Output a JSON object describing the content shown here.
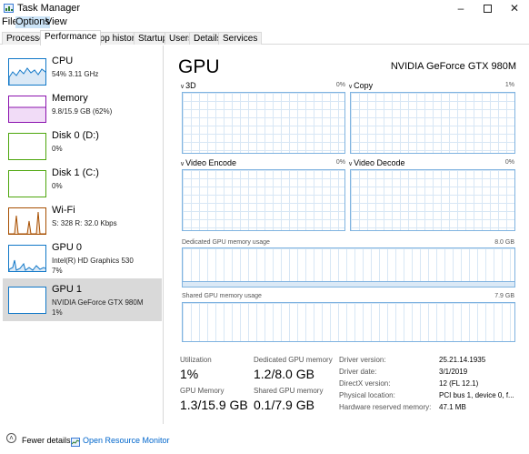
{
  "window": {
    "title": "Task Manager",
    "minimize": "–",
    "close": "✕"
  },
  "menu": [
    "File",
    "Options",
    "View"
  ],
  "tabs": [
    "Processes",
    "Performance",
    "App history",
    "Startup",
    "Users",
    "Details",
    "Services"
  ],
  "active_tab": "Performance",
  "sidebar": [
    {
      "name": "CPU",
      "detail1": "54%  3.11 GHz",
      "detail2": "",
      "color": "#1178c8",
      "icon": "cpu-graph-icon"
    },
    {
      "name": "Memory",
      "detail1": "9.8/15.9 GB (62%)",
      "detail2": "",
      "color": "#8b12ae",
      "icon": "memory-graph-icon"
    },
    {
      "name": "Disk 0 (D:)",
      "detail1": "0%",
      "detail2": "",
      "color": "#4da60c",
      "icon": "disk-graph-icon"
    },
    {
      "name": "Disk 1 (C:)",
      "detail1": "0%",
      "detail2": "",
      "color": "#4da60c",
      "icon": "disk-graph-icon"
    },
    {
      "name": "Wi-Fi",
      "detail1": "S: 328  R: 32.0 Kbps",
      "detail2": "",
      "color": "#a74f01",
      "icon": "network-graph-icon"
    },
    {
      "name": "GPU 0",
      "detail1": "Intel(R) HD Graphics 530",
      "detail2": "7%",
      "color": "#1178c8",
      "icon": "gpu-graph-icon"
    },
    {
      "name": "GPU 1",
      "detail1": "NVIDIA GeForce GTX 980M",
      "detail2": "1%",
      "color": "#1178c8",
      "icon": "gpu-graph-icon"
    }
  ],
  "selected_index": 6,
  "main": {
    "title": "GPU",
    "model": "NVIDIA GeForce GTX 980M",
    "engines": [
      {
        "name": "3D",
        "pct": "0%"
      },
      {
        "name": "Copy",
        "pct": "1%"
      },
      {
        "name": "Video Encode",
        "pct": "0%"
      },
      {
        "name": "Video Decode",
        "pct": "0%"
      }
    ],
    "dedicated_label": "Dedicated GPU memory usage",
    "dedicated_max": "8.0 GB",
    "shared_label": "Shared GPU memory usage",
    "shared_max": "7.9 GB"
  },
  "stats": {
    "utilization_label": "Utilization",
    "utilization": "1%",
    "dedicated_label": "Dedicated GPU memory",
    "dedicated": "1.2/8.0 GB",
    "gpu_memory_label": "GPU Memory",
    "gpu_memory": "1.3/15.9 GB",
    "shared_label": "Shared GPU memory",
    "shared": "0.1/7.9 GB"
  },
  "info": [
    {
      "key": "Driver version:",
      "value": "25.21.14.1935"
    },
    {
      "key": "Driver date:",
      "value": "3/1/2019"
    },
    {
      "key": "DirectX version:",
      "value": "12 (FL 12.1)"
    },
    {
      "key": "Physical location:",
      "value": "PCI bus 1, device 0, f..."
    },
    {
      "key": "Hardware reserved memory:",
      "value": "47.1 MB"
    }
  ],
  "footer": {
    "fewer": "Fewer details",
    "resource_monitor": "Open Resource Monitor"
  },
  "colors": {
    "accent_blue": "#1178c8",
    "graph_border": "#7fb3e0",
    "link": "#0066cc",
    "selection": "#d9d9d9"
  }
}
